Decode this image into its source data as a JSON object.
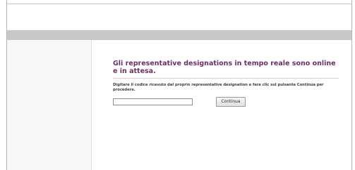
{
  "page": {
    "heading": "Gli representative designations in tempo reale sono online e in attesa.",
    "instructions": "Digitare il codice ricevuto dal proprio representative designation e fare clic sul pulsante Continua per procedere."
  },
  "form": {
    "code_value": "",
    "code_placeholder": "",
    "continue_label": "Continua"
  },
  "colors": {
    "heading": "#6b2f66",
    "band": "#c8c8c8"
  }
}
